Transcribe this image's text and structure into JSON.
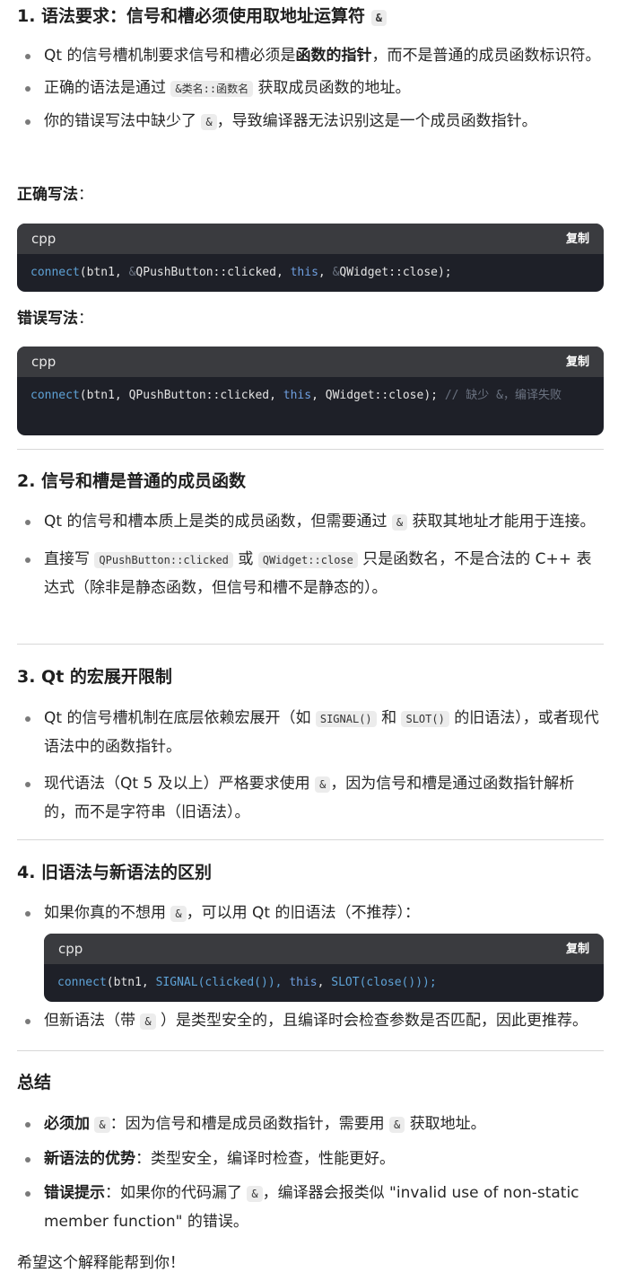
{
  "section1": {
    "heading": "1. 语法要求：信号和槽必须使用取地址运算符",
    "heading_code": "&",
    "bullets": [
      {
        "pre": "Qt 的信号槽机制要求信号和槽必须是",
        "bold": "函数的指针",
        "post": "，而不是普通的成员函数标识符。"
      },
      {
        "pre": "正确的语法是通过",
        "code": "&类名::函数名",
        "post": "获取成员函数的地址。"
      },
      {
        "pre": "你的错误写法中缺少了",
        "code": "&",
        "post": "，导致编译器无法识别这是一个成员函数指针。"
      }
    ],
    "correct_label_bold": "正确写法",
    "correct_label_colon": "：",
    "wrong_label_bold": "错误写法",
    "wrong_label_colon": "："
  },
  "code_correct": {
    "lang": "cpp",
    "copy": "复制",
    "tokens": [
      "connect",
      "(btn1, ",
      "&",
      "QPushButton::clicked, ",
      "this",
      ", ",
      "&",
      "QWidget::close);"
    ]
  },
  "code_wrong": {
    "lang": "cpp",
    "copy": "复制",
    "tokens": [
      "connect",
      "(btn1, QPushButton::clicked, ",
      "this",
      ", QWidget::close); ",
      "// 缺少 &，编译失败"
    ]
  },
  "section2": {
    "heading": "2. 信号和槽是普通的成员函数",
    "bullets": [
      {
        "pre": "Qt 的信号和槽本质上是类的成员函数，但需要通过",
        "code": "&",
        "post": "获取其地址才能用于连接。"
      },
      {
        "pre": "直接写",
        "code": "QPushButton::clicked",
        "mid": "或",
        "code2": "QWidget::close",
        "post": "只是函数名，不是合法的 C++ 表达式（除非是静态函数，但信号和槽不是静态的）。"
      }
    ]
  },
  "section3": {
    "heading": "3. Qt 的宏展开限制",
    "bullets": [
      {
        "pre": "Qt 的信号槽机制在底层依赖宏展开（如",
        "code": "SIGNAL()",
        "mid": "和",
        "code2": "SLOT()",
        "post": "的旧语法），或者现代语法中的函数指针。"
      },
      {
        "pre": "现代语法（Qt 5 及以上）严格要求使用",
        "code": "&",
        "post": "，因为信号和槽是通过函数指针解析的，而不是字符串（旧语法）。"
      }
    ]
  },
  "section4": {
    "heading": "4. 旧语法与新语法的区别",
    "bullets": [
      {
        "pre": "如果你真的不想用",
        "code": "&",
        "post": "，可以用 Qt 的旧语法（不推荐）："
      },
      {
        "pre": "但新语法（带",
        "code": "&",
        "post": "）是类型安全的，且编译时会检查参数是否匹配，因此更推荐。"
      }
    ]
  },
  "code_old": {
    "lang": "cpp",
    "copy": "复制",
    "tokens": [
      "connect",
      "(btn1, ",
      "SIGNAL",
      "(clicked()), ",
      "this",
      ", ",
      "SLOT",
      "(close()));"
    ]
  },
  "summary": {
    "heading": "总结",
    "bullets": [
      {
        "bold": "必须加",
        "code": "&",
        "pre": "：因为信号和槽是成员函数指针，需要用",
        "code2": "&",
        "post": "获取地址。"
      },
      {
        "bold": "新语法的优势",
        "post": "：类型安全，编译时检查，性能更好。"
      },
      {
        "bold": "错误提示",
        "pre": "：如果你的代码漏了",
        "code": "&",
        "post": "，编译器会报类似 \"invalid use of non-static member function\" 的错误。"
      }
    ]
  },
  "closing": "希望这个解释能帮到你！"
}
